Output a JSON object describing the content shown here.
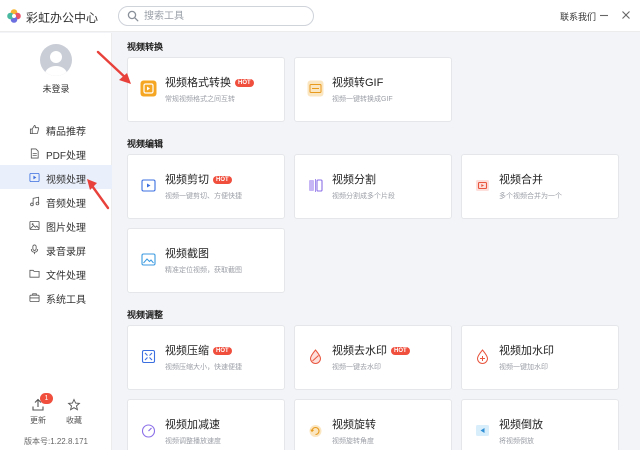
{
  "header": {
    "app_title": "彩虹办公中心",
    "search_placeholder": "搜索工具",
    "contact": "联系我们"
  },
  "sidebar": {
    "login": "未登录",
    "items": [
      {
        "label": "精品推荐",
        "icon": "thumbs-up-icon"
      },
      {
        "label": "PDF处理",
        "icon": "pdf-icon"
      },
      {
        "label": "视频处理",
        "icon": "video-icon"
      },
      {
        "label": "音频处理",
        "icon": "music-icon"
      },
      {
        "label": "图片处理",
        "icon": "image-icon"
      },
      {
        "label": "录音录屏",
        "icon": "microphone-icon"
      },
      {
        "label": "文件处理",
        "icon": "folder-icon"
      },
      {
        "label": "系统工具",
        "icon": "toolbox-icon"
      }
    ],
    "active_index": 2,
    "update_label": "更新",
    "update_badge": "1",
    "favorite_label": "收藏",
    "version": "版本号:1.22.8.171"
  },
  "sections": [
    {
      "title": "视频转换",
      "cards": [
        {
          "title": "视频格式转换",
          "desc": "常规视频格式之间互转",
          "hot": "HOT",
          "icon": "video-format-convert-icon"
        },
        {
          "title": "视频转GIF",
          "desc": "视频一键转换成GIF",
          "icon": "gif-icon"
        }
      ]
    },
    {
      "title": "视频编辑",
      "cards": [
        {
          "title": "视频剪切",
          "desc": "视频一键剪切、方便快捷",
          "hot": "HOT",
          "icon": "video-cut-icon"
        },
        {
          "title": "视频分割",
          "desc": "视频分割成多个片段",
          "icon": "video-split-icon"
        },
        {
          "title": "视频合并",
          "desc": "多个视频合并为一个",
          "icon": "video-merge-icon"
        },
        {
          "title": "视频截图",
          "desc": "精准定位视频，获取截图",
          "icon": "video-screenshot-icon"
        }
      ]
    },
    {
      "title": "视频调整",
      "cards": [
        {
          "title": "视频压缩",
          "desc": "视频压缩大小，快速便捷",
          "hot": "HOT",
          "icon": "video-compress-icon"
        },
        {
          "title": "视频去水印",
          "desc": "视频一键去水印",
          "hot": "HOT",
          "icon": "watermark-remove-icon"
        },
        {
          "title": "视频加水印",
          "desc": "视频一键加水印",
          "icon": "watermark-add-icon"
        },
        {
          "title": "视频加减速",
          "desc": "视频调整播放速度",
          "icon": "speed-icon"
        },
        {
          "title": "视频旋转",
          "desc": "视频旋转角度",
          "icon": "rotate-icon"
        },
        {
          "title": "视频倒放",
          "desc": "将视频倒放",
          "icon": "reverse-icon"
        }
      ]
    }
  ],
  "colors": {
    "accent": "#3b6fe0",
    "hot_badge": "#f04f3e",
    "annotation_arrow": "#e8403a"
  }
}
